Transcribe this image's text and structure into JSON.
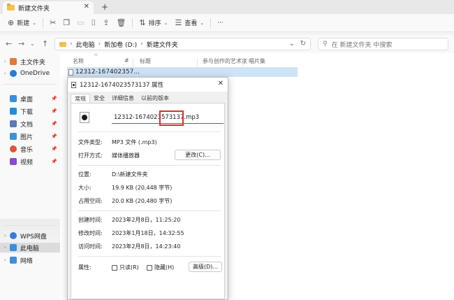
{
  "window": {
    "tab_title": "新建文件夹",
    "close_glyph": "✕",
    "new_tab_glyph": "+"
  },
  "toolbar": {
    "new_label": "新建",
    "sort_label": "排序",
    "view_label": "查看",
    "more_glyph": "···"
  },
  "address": {
    "crumbs": [
      "此电脑",
      "新加卷 (D:)",
      "新建文件夹"
    ],
    "search_placeholder": "在 新建文件夹 中搜索"
  },
  "sidebar": {
    "items": [
      {
        "label": "主文件夹",
        "icon": "home-icon",
        "color": "#e07a3a"
      },
      {
        "label": "OneDrive",
        "icon": "cloud-icon",
        "color": "#2b79d6"
      },
      {
        "label": "桌面",
        "icon": "desktop-icon",
        "color": "#3b8fd8"
      },
      {
        "label": "下载",
        "icon": "download-icon",
        "color": "#2a8ad4"
      },
      {
        "label": "文档",
        "icon": "document-icon",
        "color": "#5a7ab8"
      },
      {
        "label": "图片",
        "icon": "picture-icon",
        "color": "#3a94d8"
      },
      {
        "label": "音乐",
        "icon": "music-icon",
        "color": "#e0533a"
      },
      {
        "label": "视频",
        "icon": "video-icon",
        "color": "#8a4ad0"
      },
      {
        "label": "WPS网盘",
        "icon": "wps-cloud-icon",
        "color": "#3a7ad8"
      },
      {
        "label": "此电脑",
        "icon": "computer-icon",
        "color": "#3b8fd8"
      },
      {
        "label": "网络",
        "icon": "network-icon",
        "color": "#3b8fd8"
      }
    ]
  },
  "content": {
    "columns": [
      "名称",
      "#",
      "标题",
      "参与创作的艺术家",
      "唱片集"
    ],
    "file_name": "12312-167402357..."
  },
  "dialog": {
    "title": "12312-1674023573137 属性",
    "tabs": [
      "常规",
      "安全",
      "详细信息",
      "以前的版本"
    ],
    "file_name_value": "12312-1674023573137.mp3",
    "rows": {
      "type_label": "文件类型:",
      "type_value": "MP3 文件 (.mp3)",
      "open_label": "打开方式:",
      "open_value": "媒体播放器",
      "change_button": "更改(C)...",
      "location_label": "位置:",
      "location_value": "D:\\新建文件夹",
      "size_label": "大小:",
      "size_value": "19.9 KB (20,448 字节)",
      "disk_label": "占用空间:",
      "disk_value": "20.0 KB (20,480 字节)",
      "created_label": "创建时间:",
      "created_value": "2023年2月8日，11:25:20",
      "modified_label": "修改时间:",
      "modified_value": "2023年1月18日，14:32:55",
      "accessed_label": "访问时间:",
      "accessed_value": "2023年2月8日，14:23:40",
      "attr_label": "属性:",
      "readonly_label": "只读(R)",
      "hidden_label": "隐藏(H)",
      "advanced_button": "高级(D)..."
    }
  },
  "colors": {
    "accent": "#2f6fbf",
    "highlight_border": "#d9302e",
    "selection": "#cfe3f7",
    "folder": "#f2c14e"
  }
}
